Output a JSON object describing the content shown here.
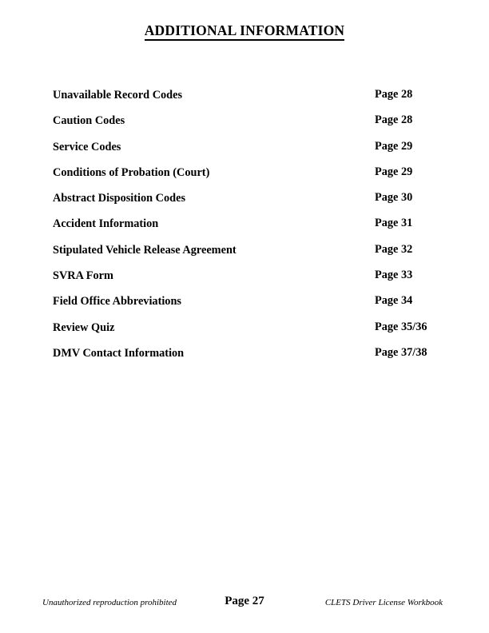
{
  "document": {
    "title": "ADDITIONAL INFORMATION"
  },
  "contents": {
    "entries": [
      {
        "label": "Unavailable Record Codes",
        "page": "Page 28"
      },
      {
        "label": "Caution Codes",
        "page": "Page 28"
      },
      {
        "label": "Service Codes",
        "page": "Page 29"
      },
      {
        "label": "Conditions of Probation (Court)",
        "page": "Page 29"
      },
      {
        "label": "Abstract Disposition Codes",
        "page": "Page 30"
      },
      {
        "label": "Accident Information",
        "page": "Page 31"
      },
      {
        "label": "Stipulated Vehicle Release Agreement",
        "page": "Page 32"
      },
      {
        "label": "SVRA Form",
        "page": "Page 33"
      },
      {
        "label": "Field Office Abbreviations",
        "page": "Page 34"
      },
      {
        "label": "Review Quiz",
        "page": "Page 35/36"
      },
      {
        "label": "DMV Contact Information",
        "page": "Page 37/38"
      }
    ]
  },
  "footer": {
    "left": "Unauthorized reproduction prohibited",
    "center": "Page 27",
    "right": "CLETS Driver License Workbook"
  },
  "colors": {
    "background": "#ffffff",
    "text": "#000000"
  }
}
